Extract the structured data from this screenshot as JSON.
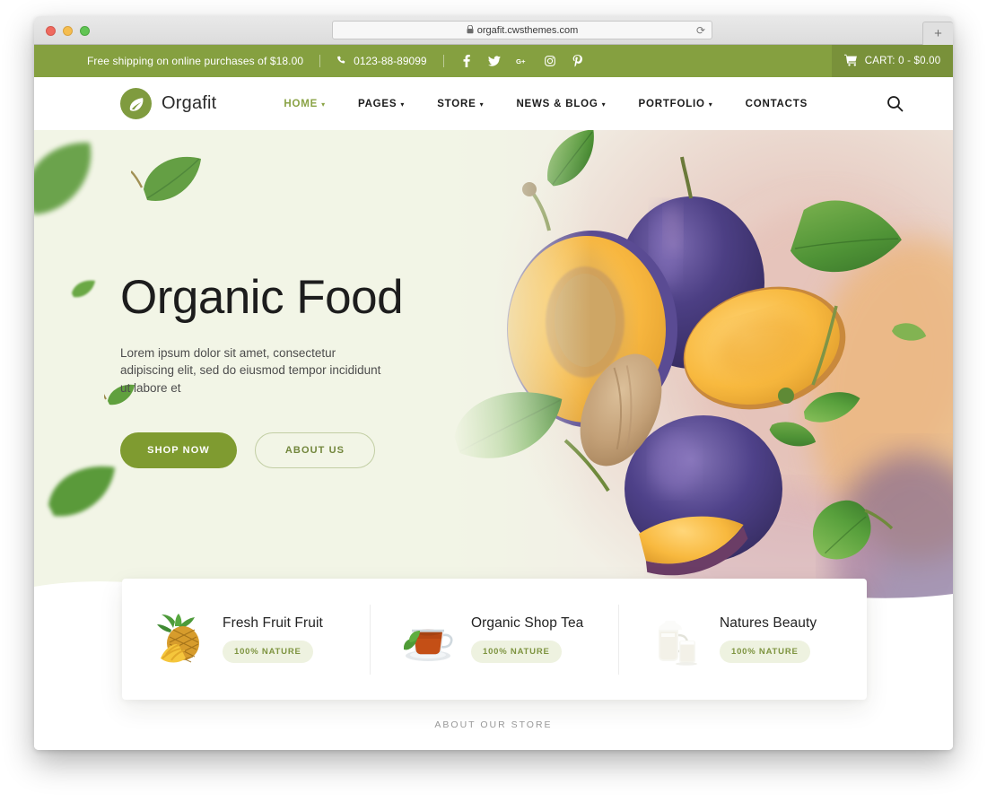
{
  "browser": {
    "url": "orgafit.cwsthemes.com",
    "lock_icon": "lock-icon",
    "reload_icon": "reload-icon",
    "new_tab_label": "+",
    "traffic_lights": [
      "close",
      "minimize",
      "zoom"
    ]
  },
  "topbar": {
    "shipping_text": "Free shipping on online purchases of $18.00",
    "phone": "0123-88-89099",
    "phone_icon": "phone-icon",
    "socials": [
      {
        "name": "facebook-icon",
        "glyph": "f"
      },
      {
        "name": "twitter-icon",
        "glyph": "t"
      },
      {
        "name": "google-plus-icon",
        "glyph": "G+"
      },
      {
        "name": "instagram-icon",
        "glyph": "ig"
      },
      {
        "name": "pinterest-icon",
        "glyph": "P"
      }
    ],
    "cart_label": "CART: 0 - $0.00",
    "cart_icon": "shopping-cart-icon",
    "bg_color": "#85a040"
  },
  "nav": {
    "brand": "Orgafit",
    "logo_icon": "leaf-circle-logo",
    "items": [
      {
        "label": "HOME",
        "has_dropdown": true,
        "active": true
      },
      {
        "label": "PAGES",
        "has_dropdown": true,
        "active": false
      },
      {
        "label": "STORE",
        "has_dropdown": true,
        "active": false
      },
      {
        "label": "NEWS & BLOG",
        "has_dropdown": true,
        "active": false
      },
      {
        "label": "PORTFOLIO",
        "has_dropdown": true,
        "active": false
      },
      {
        "label": "CONTACTS",
        "has_dropdown": false,
        "active": false
      }
    ],
    "search_icon": "search-icon",
    "active_color": "#8aa346"
  },
  "hero": {
    "title": "Organic Food",
    "subtitle": "Lorem ipsum dolor sit amet, consectetur adipiscing elit, sed do eiusmod tempor incididunt ut labore et",
    "primary_button": "SHOP NOW",
    "secondary_button": "ABOUT US",
    "bg_color": "#f2f5e6",
    "primary_color": "#7f9b30",
    "image_subject": "plums-and-leaves"
  },
  "features": [
    {
      "icon": "pineapple-icon",
      "title": "Fresh Fruit Fruit",
      "badge": "100% NATURE"
    },
    {
      "icon": "tea-cup-icon",
      "title": "Organic Shop Tea",
      "badge": "100% NATURE"
    },
    {
      "icon": "milk-jug-icon",
      "title": "Natures Beauty",
      "badge": "100% NATURE"
    }
  ],
  "below": {
    "section_label": "ABOUT OUR STORE"
  }
}
